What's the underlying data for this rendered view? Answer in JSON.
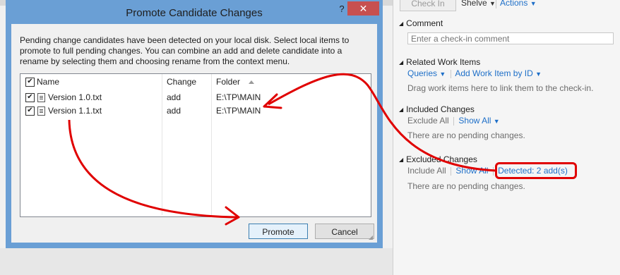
{
  "dialog": {
    "title": "Promote Candidate Changes",
    "help": "?",
    "close": "✕",
    "description": "Pending change candidates have been detected on your local disk. Select local items to promote to full pending changes. You can combine an add and delete candidate into a rename by selecting them and choosing rename from the context menu.",
    "columns": {
      "name": "Name",
      "change": "Change",
      "folder": "Folder"
    },
    "header_checked": true,
    "rows": [
      {
        "name": "Version 1.0.txt",
        "change": "add",
        "folder": "E:\\TP\\MAIN",
        "checked": true
      },
      {
        "name": "Version 1.1.txt",
        "change": "add",
        "folder": "E:\\TP\\MAIN",
        "checked": true
      }
    ],
    "promote_label": "Promote",
    "cancel_label": "Cancel"
  },
  "panel": {
    "toolbar": {
      "checkin": "Check In",
      "shelve": "Shelve",
      "actions": "Actions"
    },
    "comment": {
      "heading": "Comment",
      "placeholder": "Enter a check-in comment"
    },
    "related": {
      "heading": "Related Work Items",
      "queries": "Queries",
      "add_work_item": "Add Work Item by ID",
      "hint": "Drag work items here to link them to the check-in."
    },
    "included": {
      "heading": "Included Changes",
      "exclude_all": "Exclude All",
      "show_all": "Show All",
      "empty": "There are no pending changes."
    },
    "excluded": {
      "heading": "Excluded Changes",
      "include_all": "Include All",
      "show_all": "Show All",
      "detected": "Detected: 2 add(s)",
      "empty": "There are no pending changes."
    }
  },
  "colors": {
    "annotation": "#e00000",
    "link": "#1e6fc8",
    "titlebar": "#6a9fd5",
    "close": "#c75050"
  }
}
